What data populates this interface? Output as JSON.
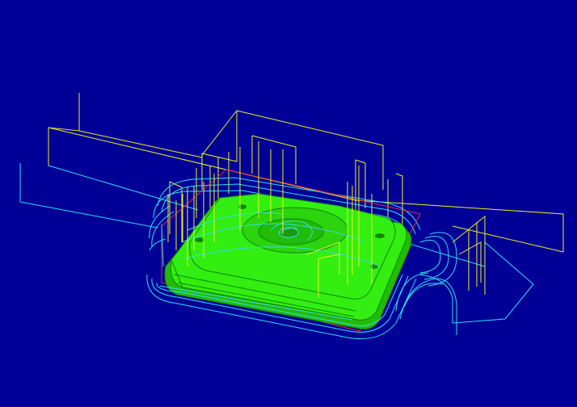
{
  "viewport": {
    "background_color": "#000096",
    "colors": {
      "part_fill": "#33ee11",
      "part_fill_dark": "#22bb08",
      "part_edge": "#118800",
      "toolpath_cut": "#33ddee",
      "toolpath_rapid": "#eeee22",
      "stock_boundary": "#ee2233"
    }
  }
}
